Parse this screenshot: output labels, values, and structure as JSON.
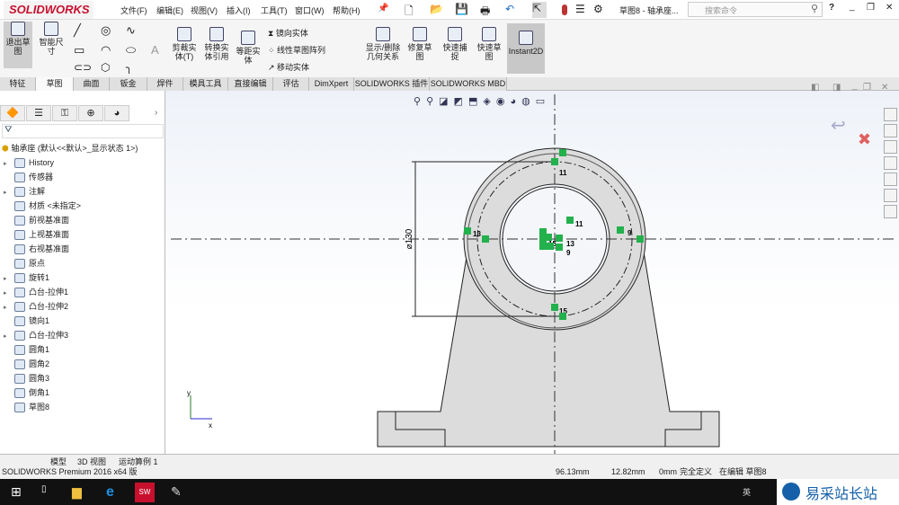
{
  "app": {
    "logo": "SOLIDWORKS",
    "document_title": "草图8 - 轴承座...",
    "search_placeholder": "搜索命令"
  },
  "menu": [
    "文件(F)",
    "编辑(E)",
    "视图(V)",
    "插入(I)",
    "工具(T)",
    "窗口(W)",
    "帮助(H)"
  ],
  "ribbon": {
    "exit_sketch": "退出草图",
    "smart_dim": "智能尺寸",
    "trim": "剪裁实体(T)",
    "convert": "转换实体引用",
    "offset": "等距实体",
    "mirror": "镜向实体",
    "linear_pattern": "线性草图阵列",
    "move": "移动实体",
    "relations": "显示/删除几何关系",
    "repair": "修复草图",
    "quick_snap": "快速捕捉",
    "rapid_sketch": "快速草图",
    "instant2d": "Instant2D"
  },
  "tabs": [
    "特征",
    "草图",
    "曲面",
    "钣金",
    "焊件",
    "模具工具",
    "直接编辑",
    "评估",
    "DimXpert",
    "SOLIDWORKS 插件",
    "SOLIDWORKS MBD"
  ],
  "active_tab": "草图",
  "tree": {
    "root": "轴承座 (默认<<默认>_显示状态 1>)",
    "items": [
      {
        "label": "History",
        "expand": true
      },
      {
        "label": "传感器",
        "expand": false
      },
      {
        "label": "注解",
        "expand": true
      },
      {
        "label": "材质 <未指定>",
        "expand": false
      },
      {
        "label": "前视基准面",
        "expand": false
      },
      {
        "label": "上视基准面",
        "expand": false
      },
      {
        "label": "右视基准面",
        "expand": false
      },
      {
        "label": "原点",
        "expand": false
      },
      {
        "label": "旋转1",
        "expand": true
      },
      {
        "label": "凸台-拉伸1",
        "expand": true
      },
      {
        "label": "凸台-拉伸2",
        "expand": true
      },
      {
        "label": "镜向1",
        "expand": false
      },
      {
        "label": "凸台-拉伸3",
        "expand": true
      },
      {
        "label": "圆角1",
        "expand": false
      },
      {
        "label": "圆角2",
        "expand": false
      },
      {
        "label": "圆角3",
        "expand": false
      },
      {
        "label": "倒角1",
        "expand": false
      },
      {
        "label": "草图8",
        "expand": false
      }
    ]
  },
  "drawing": {
    "dimension": "⌀130",
    "relations": [
      "11",
      "11",
      "13",
      "13",
      "15",
      "9",
      "9",
      "15"
    ],
    "axis_x": "x",
    "axis_y": "y"
  },
  "bottom_tabs": [
    "模型",
    "3D 视图",
    "运动算例 1"
  ],
  "status": {
    "product": "SOLIDWORKS Premium 2016 x64 版",
    "x": "96.13mm",
    "y": "12.82mm",
    "z": "0mm",
    "state": "完全定义",
    "editing": "在编辑 草图8"
  },
  "taskbar": {
    "ime": "英",
    "watermark": "易采站长站"
  },
  "colors": {
    "accent": "#c8102e",
    "relation": "#22b14c",
    "sketch_line": "#222222"
  }
}
